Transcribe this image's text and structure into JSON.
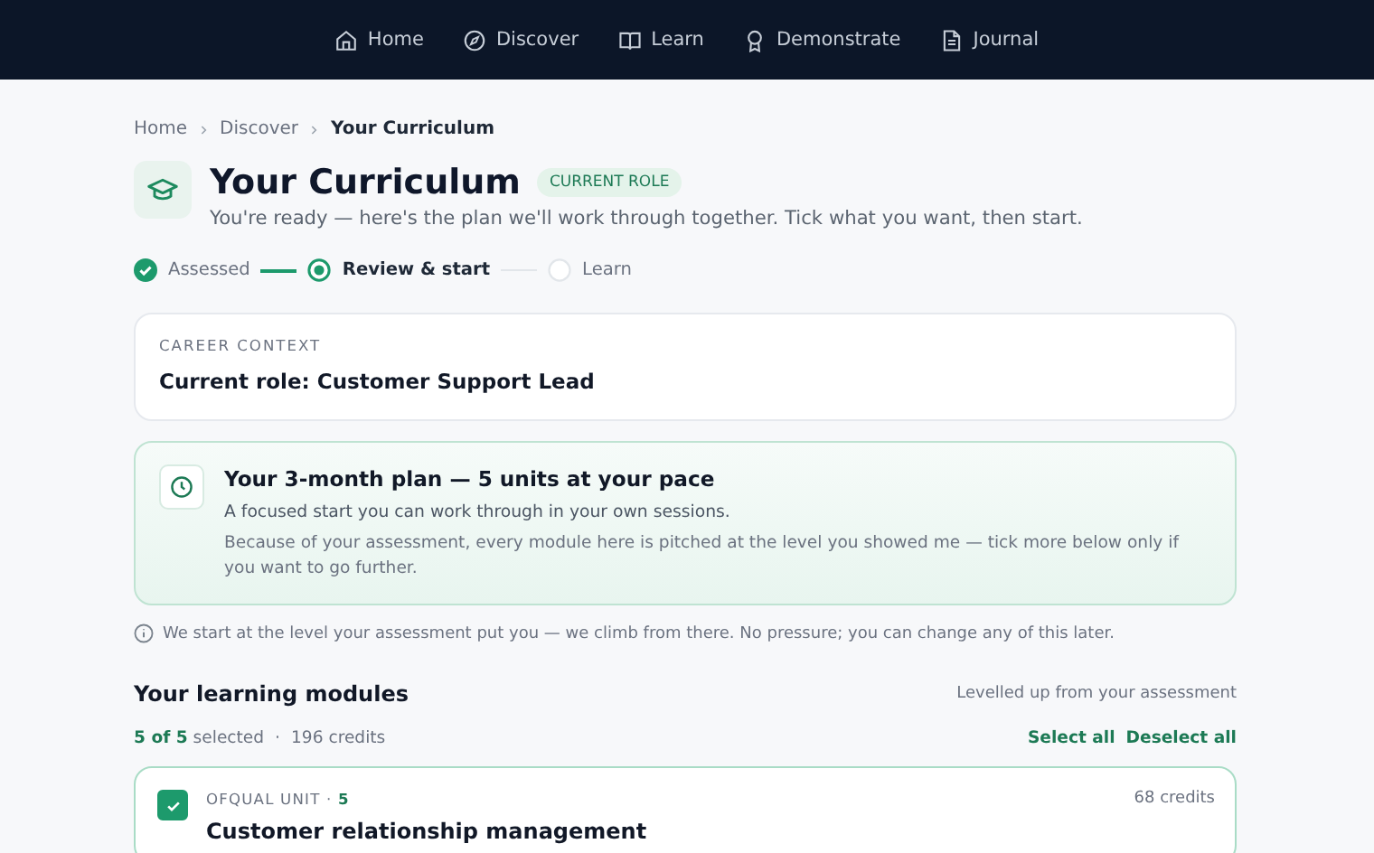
{
  "nav": {
    "items": [
      {
        "label": "Home"
      },
      {
        "label": "Discover"
      },
      {
        "label": "Learn"
      },
      {
        "label": "Demonstrate"
      },
      {
        "label": "Journal"
      }
    ]
  },
  "breadcrumb": [
    {
      "label": "Home",
      "current": false
    },
    {
      "label": "Discover",
      "current": false
    },
    {
      "label": "Your Curriculum",
      "current": true
    }
  ],
  "header": {
    "title": "Your Curriculum",
    "badge": "CURRENT ROLE",
    "subtitle": "You're ready — here's the plan we'll work through together. Tick what you want, then start."
  },
  "steps": [
    {
      "label": "Assessed",
      "completed": true,
      "selected": false
    },
    {
      "label": "Review & start",
      "completed": false,
      "selected": true
    },
    {
      "label": "Learn",
      "completed": false,
      "selected": false
    }
  ],
  "career_context": {
    "label": "CAREER CONTEXT",
    "value": "Current role: Customer Support Lead"
  },
  "plan": {
    "title": "Your 3-month plan — 5 units at your pace",
    "lead": "A focused start you can work through in your own sessions.",
    "detail": "Because of your assessment, every module here is pitched at the level you showed me — tick more below only if you want to go further."
  },
  "note": "We start at the level your assessment put you — we climb from there. No pressure; you can change any of this later.",
  "modules": {
    "title": "Your learning modules",
    "aside": "Levelled up from your assessment",
    "count": "5 of 5",
    "count_suffix": "selected",
    "separator": "·",
    "credits": "196 credits",
    "actions": [
      "Select all",
      "Deselect all"
    ],
    "items": [
      {
        "unit": "OFQUAL UNIT ·",
        "level": "5",
        "credits": "68 credits",
        "title": "Customer relationship management",
        "checked": true
      }
    ]
  }
}
